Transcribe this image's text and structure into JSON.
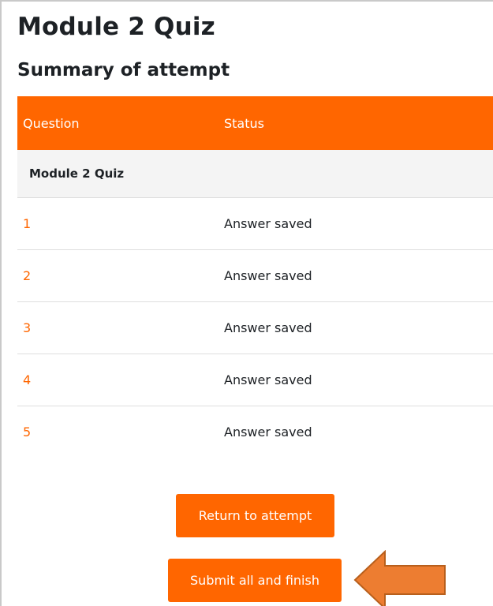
{
  "page": {
    "title": "Module 2 Quiz",
    "section_title": "Summary of attempt"
  },
  "table": {
    "headers": {
      "question": "Question",
      "status": "Status"
    },
    "group_label": "Module 2 Quiz",
    "rows": [
      {
        "question": "1",
        "status": "Answer saved"
      },
      {
        "question": "2",
        "status": "Answer saved"
      },
      {
        "question": "3",
        "status": "Answer saved"
      },
      {
        "question": "4",
        "status": "Answer saved"
      },
      {
        "question": "5",
        "status": "Answer saved"
      }
    ]
  },
  "buttons": {
    "return_label": "Return to attempt",
    "submit_label": "Submit all and finish"
  },
  "colors": {
    "accent": "#ff6600",
    "annotation_arrow": "#ed7d31"
  },
  "icons": {
    "annotation": "left-arrow-icon"
  }
}
